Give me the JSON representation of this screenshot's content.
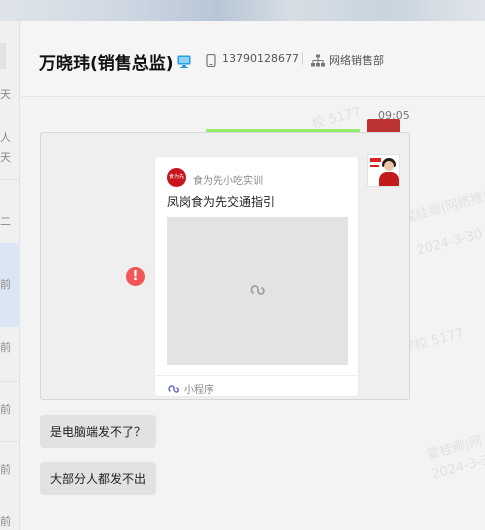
{
  "sidebar": {
    "snippets": [
      "天",
      "人",
      "天",
      "二",
      "前",
      "前",
      "前",
      "前",
      "前"
    ]
  },
  "header": {
    "contact_name": "万晓玮(销售总监)",
    "phone": "13790128677",
    "department": "网络销售部"
  },
  "chat": {
    "timestamp": "09:05",
    "mini_program": {
      "source_name": "食为先小吃实训",
      "logo_text": "食为先",
      "title": "凤岗食为先交通指引",
      "footer_label": "小程序"
    },
    "messages": [
      {
        "text": "是电脑端发不了？"
      },
      {
        "text": "大部分人都发不出"
      }
    ],
    "error_mark": "!",
    "watermarks": [
      "校 5177",
      "霍桂卿|网络推广总监",
      "2024-3-30",
      "霍桂卿|网",
      "2024-3-30",
      "学校 5177"
    ],
    "colors": {
      "sent_bubble": "#95ec69",
      "received_bubble": "#e2e2e2",
      "error": "#f25656",
      "brand_red": "#c8151d"
    }
  }
}
